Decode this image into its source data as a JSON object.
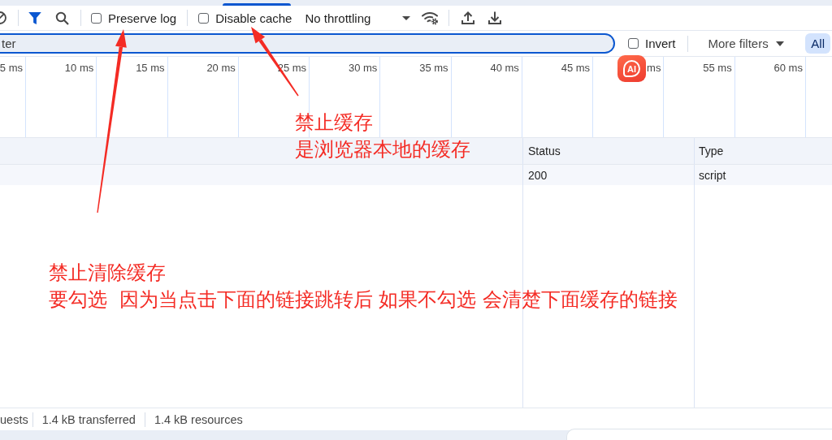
{
  "panel_tabs": [
    {
      "selected": true
    }
  ],
  "toolbar": {
    "filter_toggle": {
      "on": true
    },
    "preserve_log": {
      "label": "Preserve log",
      "checked": false
    },
    "disable_cache": {
      "label": "Disable cache",
      "checked": false
    },
    "throttling": {
      "value": "No throttling"
    }
  },
  "filter_bar": {
    "filter": {
      "placeholder": "ter",
      "focused": true
    },
    "invert": {
      "label": "Invert",
      "checked": false
    },
    "more_filters": {
      "label": "More filters"
    },
    "type_filters": [
      {
        "label": "All",
        "selected": true
      }
    ]
  },
  "timeline": {
    "ticks": [
      "5 ms",
      "10 ms",
      "15 ms",
      "20 ms",
      "25 ms",
      "30 ms",
      "35 ms",
      "40 ms",
      "45 ms",
      "ms",
      "55 ms",
      "60 ms"
    ]
  },
  "ai_badge": {
    "label": "AI"
  },
  "table": {
    "columns": [
      "Status",
      "Type"
    ],
    "rows": [
      {
        "status": "200",
        "type": "script"
      }
    ]
  },
  "status_bar": [
    "uests",
    "1.4 kB transferred",
    "1.4 kB resources"
  ],
  "annotations": [
    {
      "lines": [
        "禁止缓存",
        "是浏览器本地的缓存"
      ]
    },
    {
      "lines": [
        "禁止清除缓存",
        "要勾选  因为当点击下面的链接跳转后 如果不勾选 会清楚下面缓存的链接"
      ]
    }
  ]
}
